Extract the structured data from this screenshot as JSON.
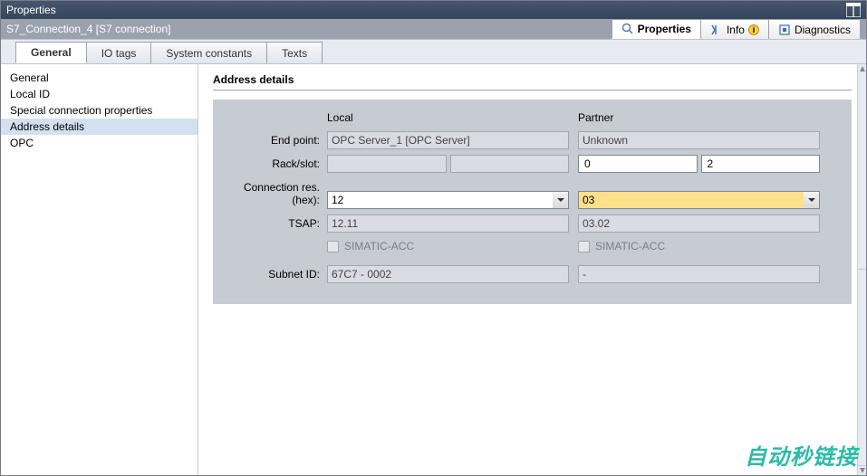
{
  "window": {
    "title": "Properties"
  },
  "subtitle": "S7_Connection_4 [S7 connection]",
  "subtabs": {
    "properties": "Properties",
    "info": "Info",
    "diagnostics": "Diagnostics"
  },
  "maintabs": {
    "general": "General",
    "io_tags": "IO tags",
    "system_constants": "System constants",
    "texts": "Texts"
  },
  "sidebar": {
    "items": [
      "General",
      "Local ID",
      "Special connection properties",
      "Address details",
      "OPC"
    ],
    "selected_index": 3
  },
  "section": {
    "title": "Address details",
    "col_local": "Local",
    "col_partner": "Partner",
    "rows": {
      "endpoint": {
        "label": "End point:",
        "local": "OPC Server_1 [OPC Server]",
        "partner": "Unknown"
      },
      "rackslot": {
        "label": "Rack/slot:",
        "local_a": "",
        "local_b": "",
        "partner_a": "0",
        "partner_b": "2"
      },
      "connres": {
        "label_line1": "Connection res.",
        "label_line2": "(hex):",
        "local": "12",
        "partner": "03"
      },
      "tsap": {
        "label": "TSAP:",
        "local": "12.11",
        "partner": "03.02"
      },
      "simatic_acc": {
        "label": "SIMATIC-ACC"
      },
      "subnet": {
        "label": "Subnet ID:",
        "local": "67C7 - 0002",
        "partner": "-"
      }
    }
  },
  "watermark": "自动秒链接"
}
